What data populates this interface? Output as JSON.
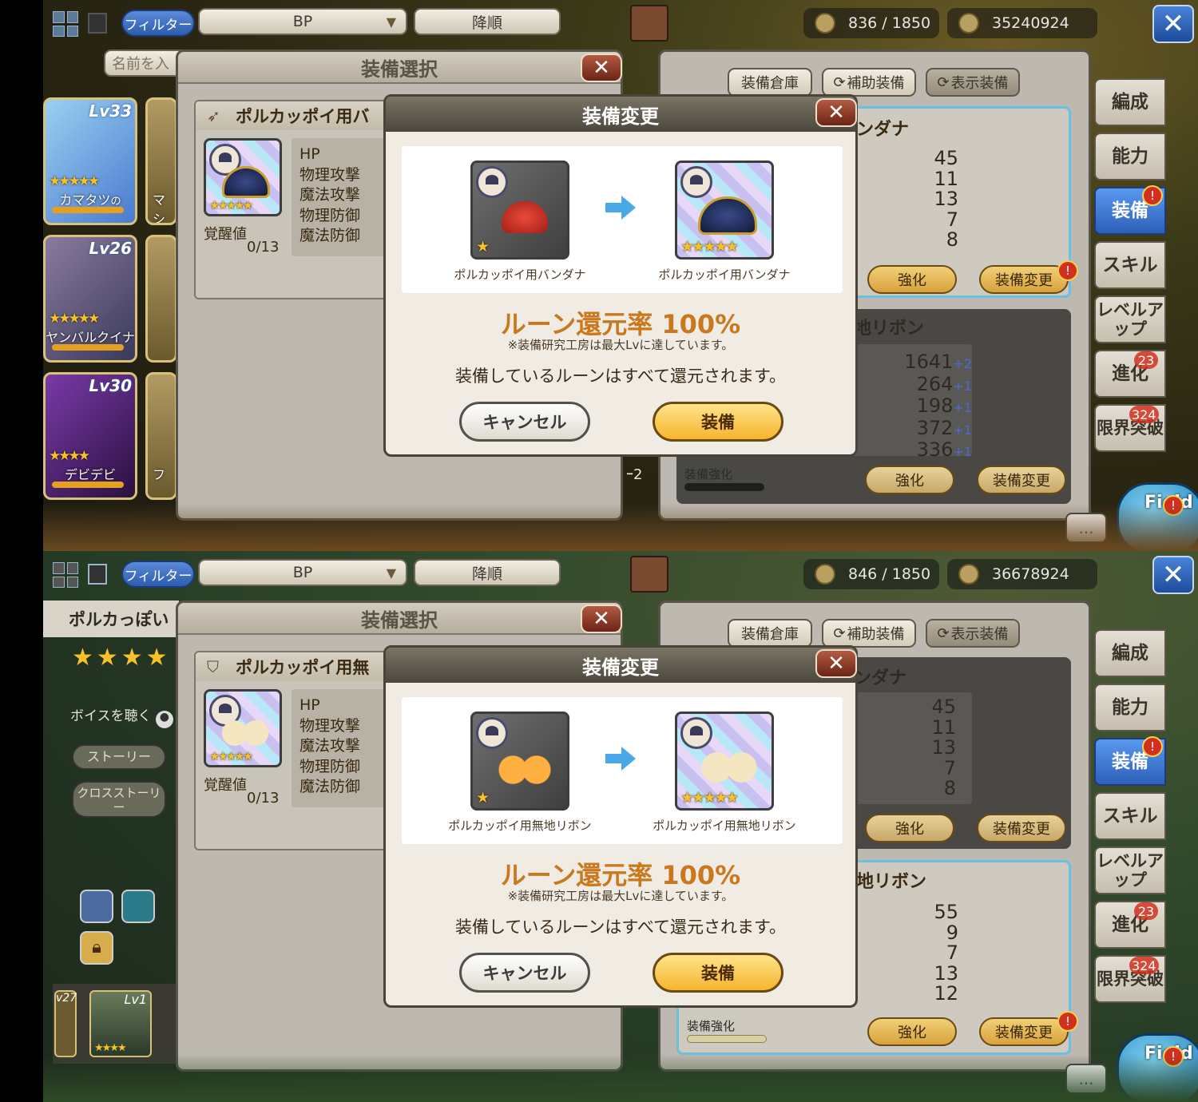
{
  "top": {
    "filter_label": "フィルター",
    "sort_select": "BP",
    "order_label": "降順",
    "stamina_a": "836 / 1850",
    "coins_a": "35240924",
    "stamina_b": "846 / 1850",
    "coins_b": "36678924"
  },
  "search_placeholder": "名前を入",
  "equip_select": {
    "title": "装備選択",
    "item_a": "ポルカッポイ用バ",
    "item_b": "ポルカッポイ用無",
    "stats": [
      "HP",
      "物理攻撃",
      "魔法攻撃",
      "物理防御",
      "魔法防御"
    ],
    "awaken_label": "覚醒値",
    "awaken_value": "0/13"
  },
  "modal": {
    "title": "装備変更",
    "rate": "ルーン還元率 100%",
    "note": "※装備研究工房は最大Lvに達しています。",
    "message": "装備しているルーンはすべて還元されます。",
    "cancel": "キャンセル",
    "confirm": "装備",
    "a_from": "ポルカッポイ用バンダナ",
    "a_to": "ポルカッポイ用バンダナ",
    "b_from": "ポルカッポイ用無地リボン",
    "b_to": "ポルカッポイ用無地リボン"
  },
  "right": {
    "tabs": [
      "装備倉庫",
      "補助装備",
      "表示装備"
    ],
    "slot1_name": "ンダナ",
    "slot2_name": "地リボン",
    "a_slot1_vals": [
      "45",
      "11",
      "13",
      "7",
      "8"
    ],
    "a_slot2_vals": [
      "1641",
      "264",
      "198",
      "372",
      "336"
    ],
    "a_slot2_plus": [
      "+2",
      "+1",
      "+1",
      "+1",
      "+1"
    ],
    "b_slot1_vals": [
      "45",
      "11",
      "13",
      "7",
      "8"
    ],
    "b_slot2_vals": [
      "55",
      "9",
      "7",
      "13",
      "12"
    ],
    "enhance": "強化",
    "change": "装備変更",
    "enhance_label": "装備強化",
    "a_partial": "ｰ2"
  },
  "side": {
    "items": [
      "編成",
      "能力",
      "装備",
      "スキル",
      "レベルアップ",
      "進化",
      "限界突破"
    ],
    "evolve_badge": "23",
    "limit_badge": "324"
  },
  "field_label": "Field",
  "chat_label": "...",
  "cards": [
    {
      "lv": "Lv33",
      "name": "カマタツ",
      "suffix": "の"
    },
    {
      "lv": "Lv26",
      "name": "ヤンバルクイナ"
    },
    {
      "lv": "Lv30",
      "name": "デビデビ"
    }
  ],
  "card_partial": [
    "マシ",
    "フ"
  ],
  "b_left": {
    "name": "ポルカっぽい",
    "voice": "ボイスを聴く",
    "story": "ストーリー",
    "cross_story": "クロスストーリー",
    "lv_a": "v27",
    "lv_b": "Lv1"
  }
}
